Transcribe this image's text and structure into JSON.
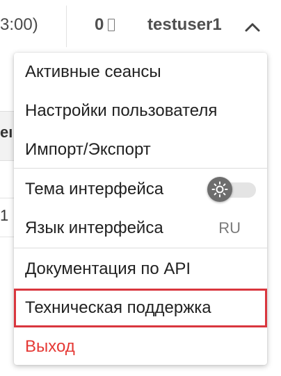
{
  "topbar": {
    "time_partial": "3:00)",
    "counter_value": "0",
    "counter_icon": "document-icon",
    "username": "testuser1",
    "menu_toggle_icon": "chevron-up-icon"
  },
  "background": {
    "strip_text": "eı",
    "row_text": "1"
  },
  "menu": {
    "items": [
      {
        "label": "Активные сеансы"
      },
      {
        "label": "Настройки пользователя"
      },
      {
        "label": "Импорт/Экспорт"
      },
      {
        "label": "Тема интерфейса",
        "control": "toggle",
        "toggle_on": false,
        "toggle_icon": "sun-icon"
      },
      {
        "label": "Язык интерфейса",
        "value": "RU"
      },
      {
        "label": "Документация по API"
      },
      {
        "label": "Техническая поддержка",
        "highlighted": true
      },
      {
        "label": "Выход",
        "color": "#e53935"
      }
    ]
  },
  "colors": {
    "highlight_border": "#d9363e",
    "logout_text": "#e53935",
    "toggle_knob": "#6d6d6d",
    "toggle_track": "#e4e4e4"
  }
}
